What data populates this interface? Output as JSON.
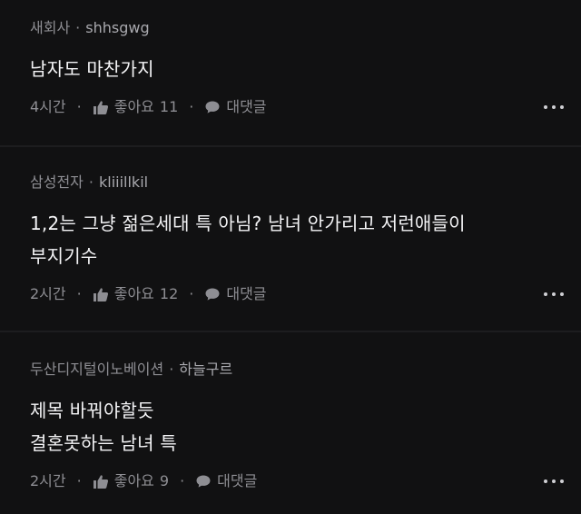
{
  "comments": [
    {
      "company": "새회사",
      "user": "shhsgwg",
      "lines": [
        "남자도 마찬가지"
      ],
      "time": "4시간",
      "like_label": "좋아요",
      "like_count": "11",
      "reply_label": "대댓글",
      "more_icon": "more-horizontal-icon"
    },
    {
      "company": "삼성전자",
      "user": "kliiillkil",
      "lines": [
        "1,2는 그냥 젊은세대 특 아님? 남녀 안가리고 저런애들이",
        "부지기수"
      ],
      "time": "2시간",
      "like_label": "좋아요",
      "like_count": "12",
      "reply_label": "대댓글",
      "more_icon": "more-horizontal-icon"
    },
    {
      "company": "두산디지털이노베이션",
      "user": "하늘구르",
      "lines": [
        "제목 바꿔야할듯",
        "결혼못하는 남녀 특"
      ],
      "time": "2시간",
      "like_label": "좋아요",
      "like_count": "9",
      "reply_label": "대댓글",
      "more_icon": "more-horizontal-icon"
    }
  ],
  "separator": "·",
  "colors": {
    "background": "#111112",
    "text": "#f4f4f6",
    "muted": "#8e8e93"
  }
}
